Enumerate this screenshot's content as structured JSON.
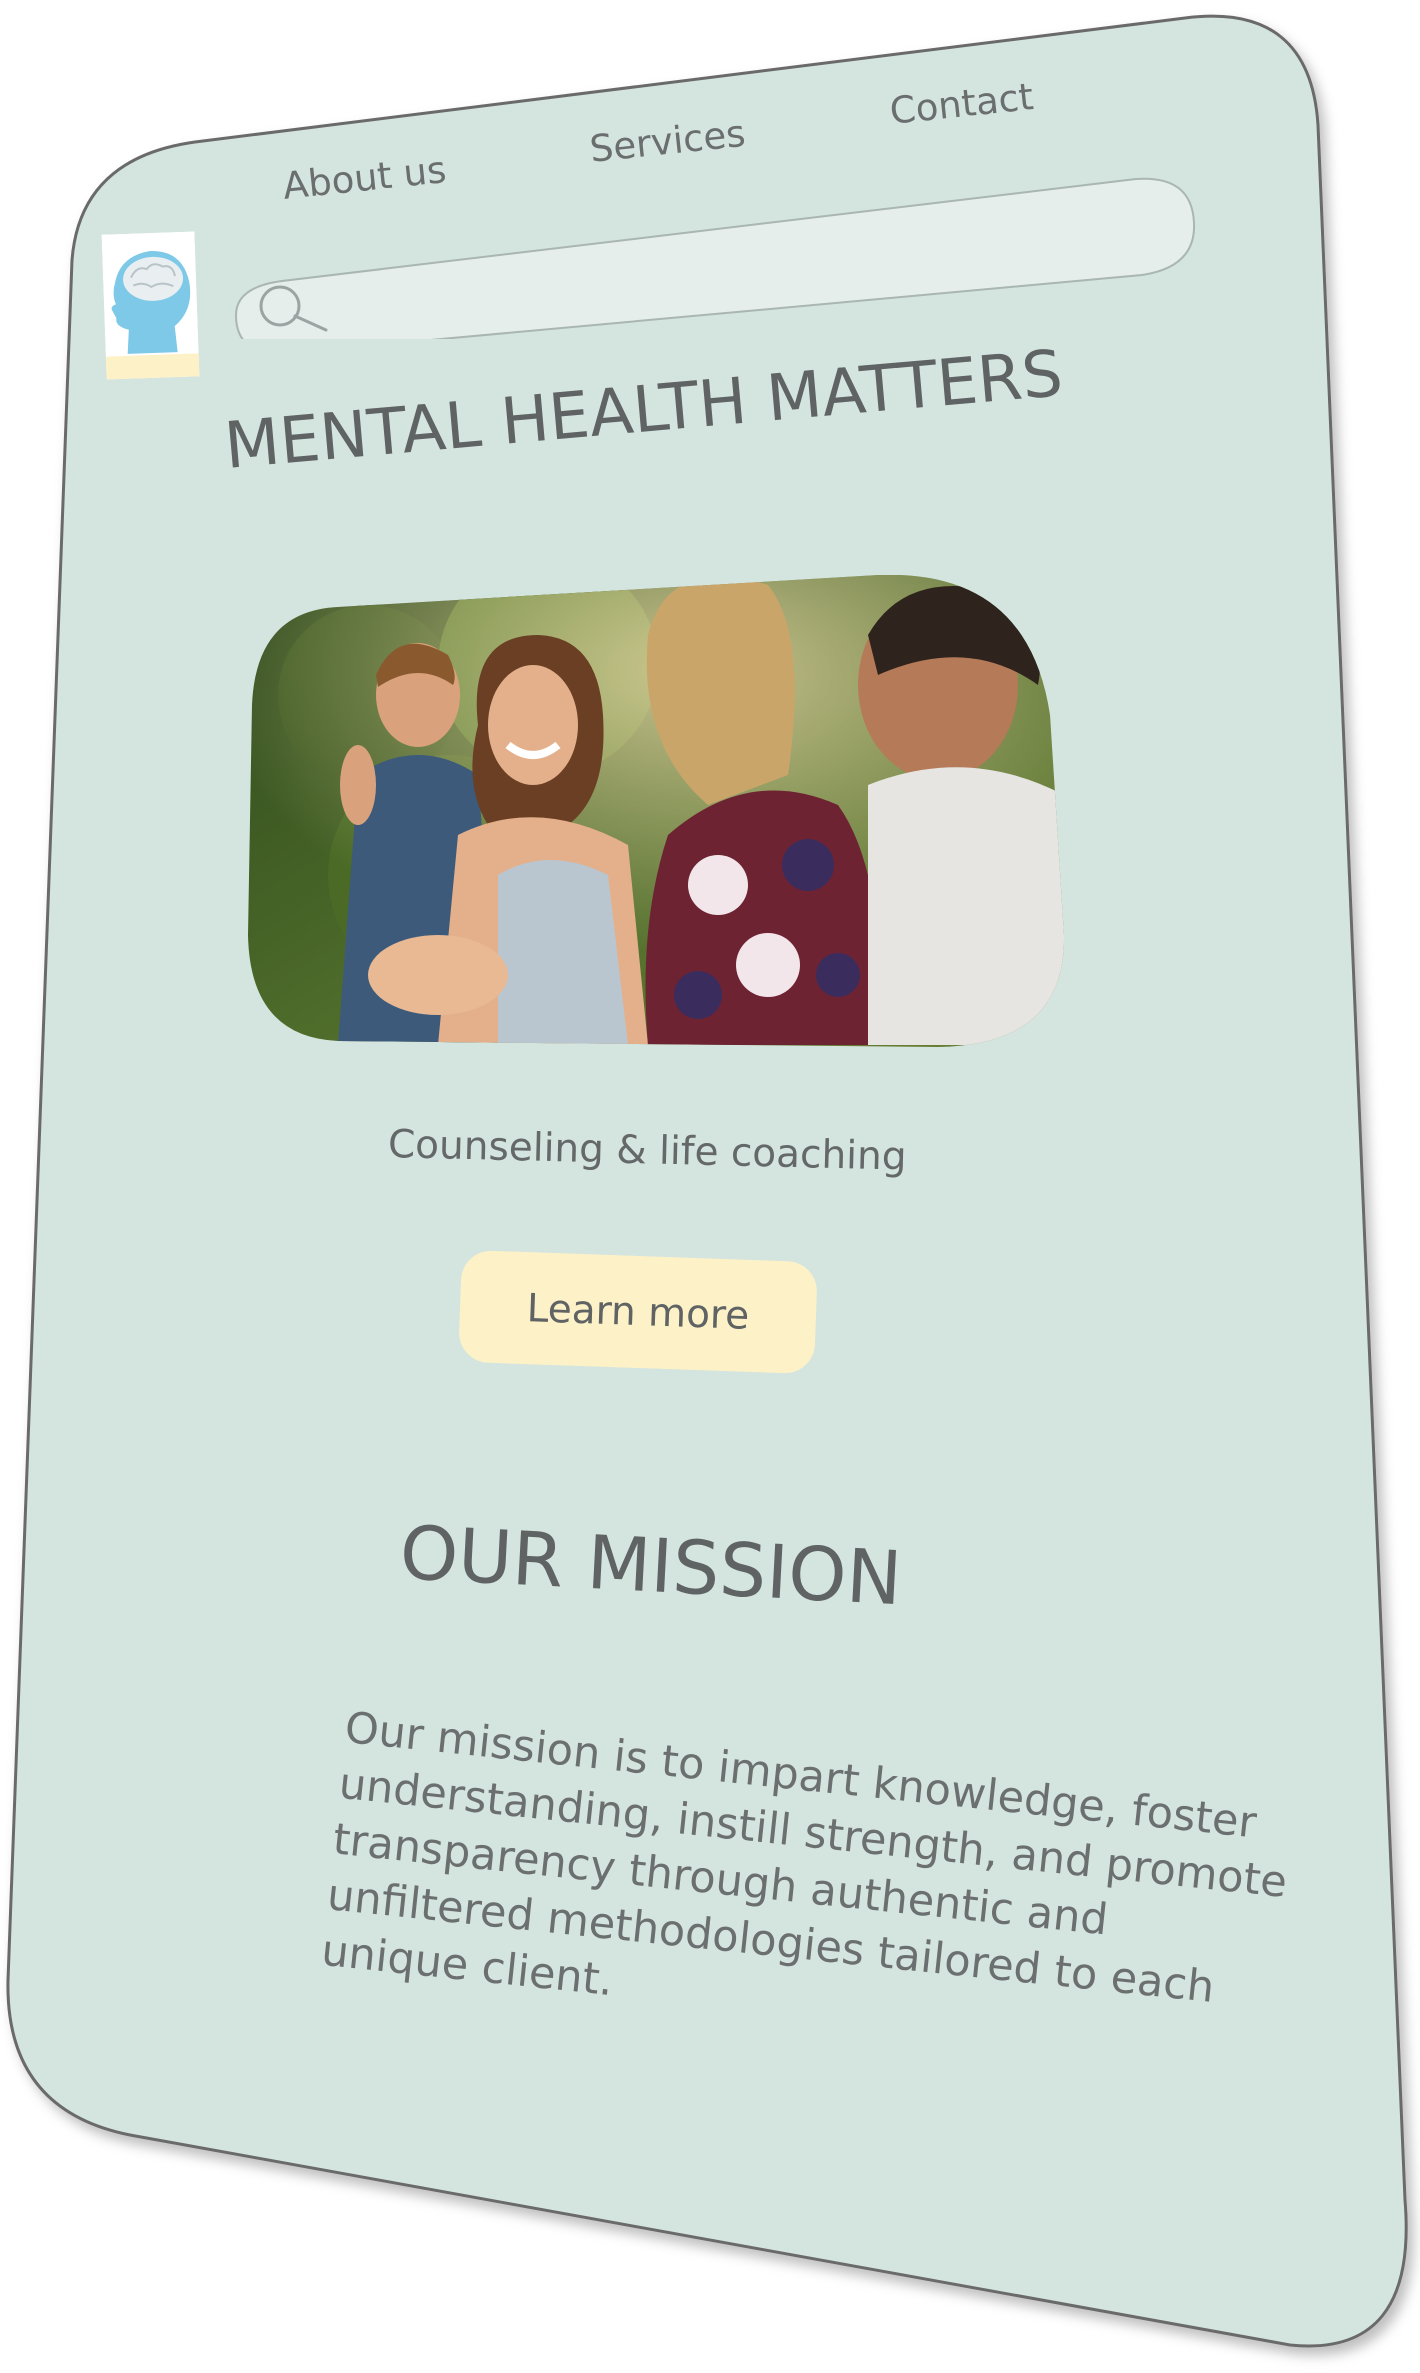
{
  "nav": {
    "about_label": "About us",
    "services_label": "Services",
    "contact_label": "Contact"
  },
  "search": {
    "placeholder": ""
  },
  "hero": {
    "headline": "MENTAL HEALTH MATTERS",
    "tagline": "Counseling & life coaching",
    "cta_label": "Learn more"
  },
  "mission": {
    "heading": "OUR MISSION",
    "body": "Our mission is to impart knowledge, foster understanding, instill strength, and promote transparency through authentic and unfiltered methodologies tailored to each unique client."
  },
  "icons": {
    "logo": "head-brain-logo",
    "search": "search-icon"
  },
  "colors": {
    "card_background": "#d4e4df",
    "card_border": "#6b6b6b",
    "search_background": "#e6eeeb",
    "cta_background": "#fdf1c8",
    "text": "#5f6363",
    "logo_head": "#7ec9e8",
    "logo_base": "#fdf1c8"
  }
}
